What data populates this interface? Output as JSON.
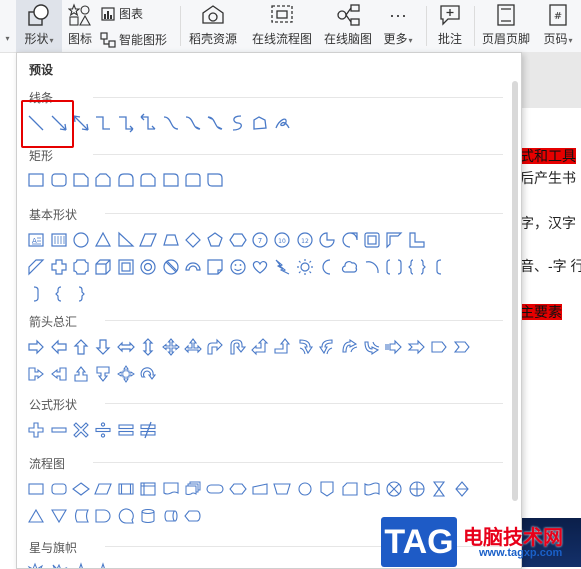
{
  "ribbon": {
    "shape_button": "形状",
    "icon_button": "图标",
    "chart_button": "图表",
    "smart_art_button": "智能图形",
    "docer_button": "稻壳资源",
    "flowchart_button": "在线流程图",
    "mindmap_button": "在线脑图",
    "more_button": "更多",
    "comment_button": "批注",
    "header_footer_button": "页眉页脚",
    "page_number_button": "页码"
  },
  "panel": {
    "title": "预设",
    "sections": {
      "lines": "线条",
      "rectangles": "矩形",
      "basic": "基本形状",
      "arrows": "箭头总汇",
      "equation": "公式形状",
      "flowchart": "流程图",
      "stars": "星与旗帜"
    }
  },
  "document": {
    "line1": "式和工具",
    "line2": "后产生书",
    "line3": "字，汉字",
    "line4": "音、-字 行",
    "line5": "主要素"
  },
  "watermark": {
    "tag": "TAG",
    "site_name": "电脑技术网",
    "url": "www.tagxp.com"
  },
  "colors": {
    "highlight_red": "#e60000",
    "icon_blue": "#4a7ac8",
    "watermark_blue": "#1e5bc6"
  }
}
